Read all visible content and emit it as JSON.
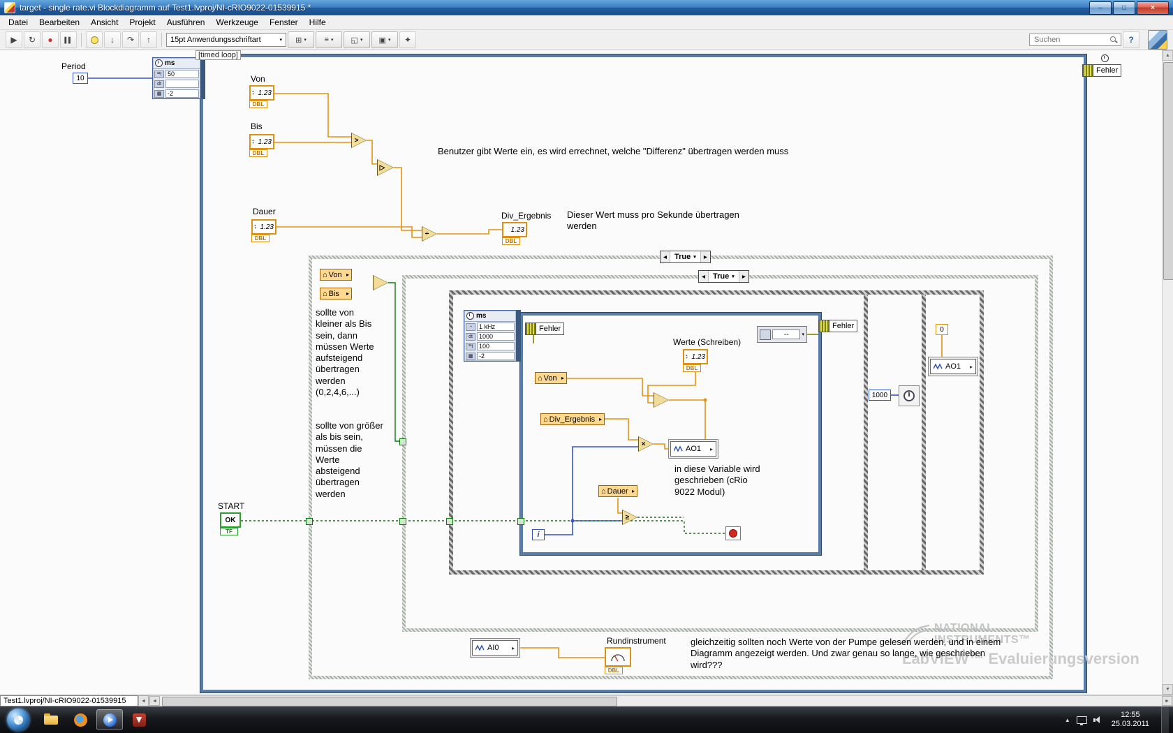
{
  "window": {
    "title": "target - single rate.vi Blockdiagramm auf Test1.lvproj/NI-cRIO9022-01539915 *",
    "status": "Test1.lvproj/NI-cRIO9022-01539915",
    "controls": {
      "min": "–",
      "max": "□",
      "close": "×"
    }
  },
  "menu": {
    "items": [
      "Datei",
      "Bearbeiten",
      "Ansicht",
      "Projekt",
      "Ausführen",
      "Werkzeuge",
      "Fenster",
      "Hilfe"
    ]
  },
  "toolbar": {
    "font": "15pt Anwendungsschriftart",
    "search_placeholder": "Suchen",
    "help": "?",
    "icons": {
      "run": "▶",
      "run_continuous": "↻",
      "abort": "●",
      "pause": "▌▌",
      "step_into": "↓",
      "step_over": "↷",
      "step_out": "↑",
      "align": "⊞",
      "distribute": "≡",
      "resize": "◱",
      "reorder": "▣",
      "cleanup": "✦",
      "dropdown": "▾"
    }
  },
  "diagram": {
    "loop_tag": "[timed loop]",
    "period": {
      "label": "Period",
      "value": "10"
    },
    "cfg_outer": {
      "header": "ms",
      "rows": [
        [
          "³²t",
          "50"
        ],
        [
          "dt",
          ""
        ],
        [
          "▩",
          "-2"
        ]
      ]
    },
    "cfg_inner": {
      "header": "ms",
      "rows": [
        [
          "◔",
          "1 kHz"
        ],
        [
          "dt",
          "1000"
        ],
        [
          "³²t",
          "100"
        ],
        [
          "▩",
          "-2"
        ]
      ]
    },
    "controls": {
      "von": {
        "label": "Von",
        "value": "1.23",
        "type": "DBL"
      },
      "bis": {
        "label": "Bis",
        "value": "1.23",
        "type": "DBL"
      },
      "dauer": {
        "label": "Dauer",
        "value": "1.23",
        "type": "DBL"
      },
      "werte": {
        "label": "Werte (Schreiben)",
        "value": "1.23",
        "type": "DBL"
      },
      "div_ergebnis": {
        "label": "Div_Ergebnis",
        "value": "1.23",
        "type": "DBL"
      }
    },
    "locals": {
      "von": "Von",
      "bis": "Bis",
      "div_ergebnis": "Div_Ergebnis",
      "dauer": "Dauer"
    },
    "shared": {
      "ao1": "AO1",
      "ai0": "AI0"
    },
    "fehler_label": "Fehler",
    "case_true": "True",
    "nodes": {
      "gt": ">",
      "select": "▷",
      "divide": "÷",
      "compare": "",
      "multiply1": "",
      "multiply2": "×",
      "greater_equal": "≥"
    },
    "constants": {
      "c1000": "1000",
      "c0": "0"
    },
    "ring_value": "--",
    "iteration": "i",
    "start": {
      "label": "START",
      "value": "OK",
      "type": "TF"
    },
    "gauge": {
      "label": "Rundinstrument",
      "type": "DBL"
    },
    "glyphs": {
      "house": "⌂",
      "right_arrow": "▸",
      "left_tri": "◀",
      "right_tri": "▶",
      "dropdown": "▾",
      "spin_up": "▴",
      "spin_down": "▾",
      "scroll_left": "◄",
      "scroll_right": "►",
      "scroll_up": "▲",
      "scroll_down": "▼"
    },
    "comments": {
      "c1": "Benutzer gibt Werte ein, es wird errechnet, welche \"Differenz\" übertragen werden muss",
      "c2": "Dieser Wert muss pro Sekunde übertragen\nwerden",
      "c3": "in diese Variable wird\ngeschrieben (cRio\n9022 Modul)",
      "c4": "gleichzeitig sollten noch Werte von der Pumpe gelesen werden, und in einem\nDiagramm angezeigt werden. Und zwar genau so lange, wie geschrieben\nwird???",
      "t1": "sollte von\nkleiner als Bis\nsein, dann\nmüssen Werte\naufsteigend\nübertragen\nwerden\n(0,2,4,6,...)",
      "t2": "sollte von größer\nals bis sein,\nmüssen die\nWerte\nabsteigend\nübertragen\nwerden"
    },
    "watermark": {
      "ni1": "NATIONAL",
      "ni2": "INSTRUMENTS™",
      "lv": "LabVIEW™  Evaluierungsversion"
    }
  },
  "taskbar": {
    "time": "12:55",
    "date": "25.03.2011"
  }
}
